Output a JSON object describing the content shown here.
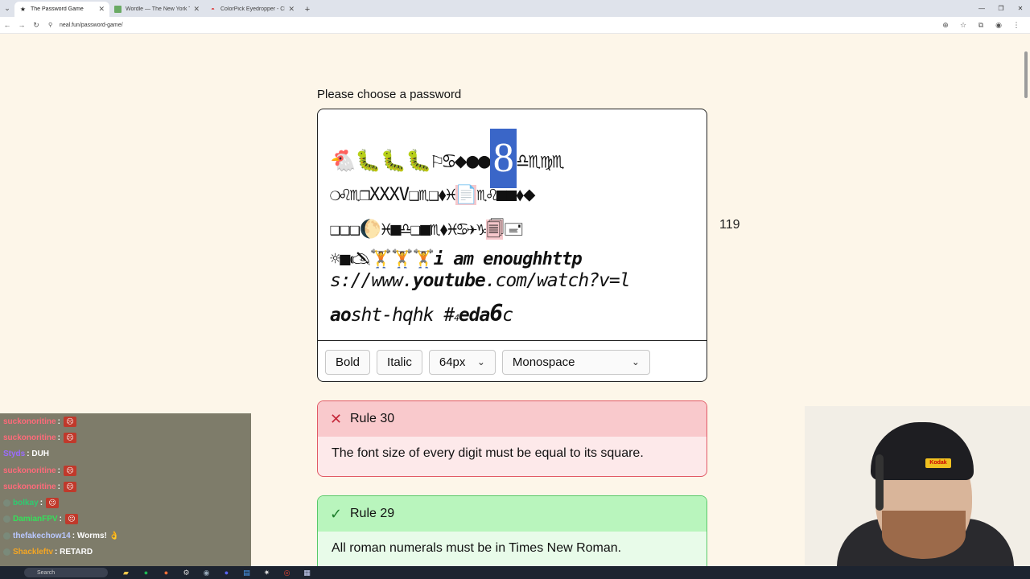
{
  "browser": {
    "tabs": [
      {
        "label": "The Password Game",
        "active": true
      },
      {
        "label": "Wordle — The New York Times",
        "active": false
      },
      {
        "label": "ColorPick Eyedropper - Chrome",
        "active": false
      }
    ],
    "url": "neal.fun/password-game/"
  },
  "page": {
    "prompt": "Please choose a password",
    "password": {
      "line1_pre": "🐔🐛🐛🐛⚐♋◆●●",
      "line1_sel": "8",
      "line1_post": "♎♏♍♏",
      "line2": "❍♌♏❒XXXV❑♏❑⬧♓",
      "line2_hl": "📄",
      "line2_post": "♏♌■■⬧⬥",
      "line3": "❑❑❑🌔♓■♎❑■♏⬧♓♋✈♑",
      "line3_hl": "🗐",
      "line3_post": "🖃",
      "line4_pre": "☼■🖎🏋🏋🏋",
      "line4_post": "i am enoughhttp",
      "line5_a": "s://www.",
      "line5_b": "youtube",
      "line5_c": ".com/watch?v=l",
      "line6_a": "ao",
      "line6_b": "sht-hqhk #",
      "line6_c": "4",
      "line6_d": "eda",
      "line6_e": "6",
      "line6_f": "c"
    },
    "char_count": "119",
    "toolbar": {
      "bold_label": "Bold",
      "italic_label": "Italic",
      "size_value": "64px",
      "font_value": "Monospace"
    },
    "rules": [
      {
        "status": "fail",
        "title": "Rule 30",
        "text": "The font size of every digit must be equal to its square."
      },
      {
        "status": "pass",
        "title": "Rule 29",
        "text": "All roman numerals must be in Times New Roman."
      }
    ]
  },
  "chat": [
    {
      "user": "suckonoritine",
      "sep": " :",
      "msg": "",
      "color": "#ff6a7a"
    },
    {
      "user": "suckonoritine",
      "sep": " :",
      "msg": "",
      "color": "#ff6a7a"
    },
    {
      "user": "Styds",
      "sep": " :",
      "msg": "DUH",
      "color": "#9a6bff"
    },
    {
      "user": "suckonoritine",
      "sep": " :",
      "msg": "",
      "color": "#ff6a7a"
    },
    {
      "user": "suckonoritine",
      "sep": " :",
      "msg": "",
      "color": "#ff6a7a"
    },
    {
      "user": "bolkay",
      "sep": " :",
      "msg": "",
      "color": "#2ecc71"
    },
    {
      "user": "DamianFPV",
      "sep": " :",
      "msg": "",
      "color": "#34e05a"
    },
    {
      "user": "thefakechow14",
      "sep": " :",
      "msg": "Worms! 👌",
      "color": "#b9c8ff"
    },
    {
      "user": "Shackleftv",
      "sep": " :",
      "msg": "RETARD",
      "color": "#f5a623"
    }
  ],
  "webcam": {
    "cap_logo": "Kodak"
  },
  "taskbar": {
    "search_placeholder": "Search"
  }
}
